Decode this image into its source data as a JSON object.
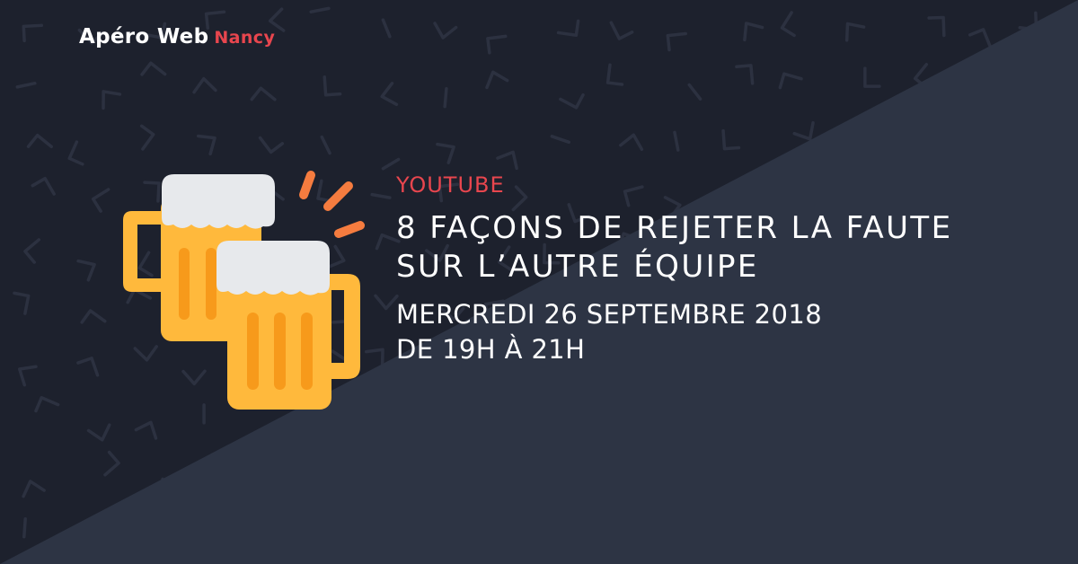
{
  "brand": {
    "name": "Apéro Web",
    "city": "Nancy"
  },
  "event": {
    "category": "YOUTUBE",
    "title_lines": [
      "8 FAÇONS DE REJETER LA FAUTE",
      "SUR L’AUTRE ÉQUIPE"
    ],
    "date_lines": [
      "MERCREDI 26 SEPTEMBRE 2018",
      "DE 19H À 21H"
    ]
  },
  "icon": "clinking-beer-mugs-icon",
  "colors": {
    "background_dark": "#1d212d",
    "background_light": "#2d3444",
    "accent": "#e8464e",
    "beer": "#ffb93c",
    "beer_stripe": "#f79a1b",
    "foam": "#e7e9ec",
    "splash": "#f57c3f"
  }
}
